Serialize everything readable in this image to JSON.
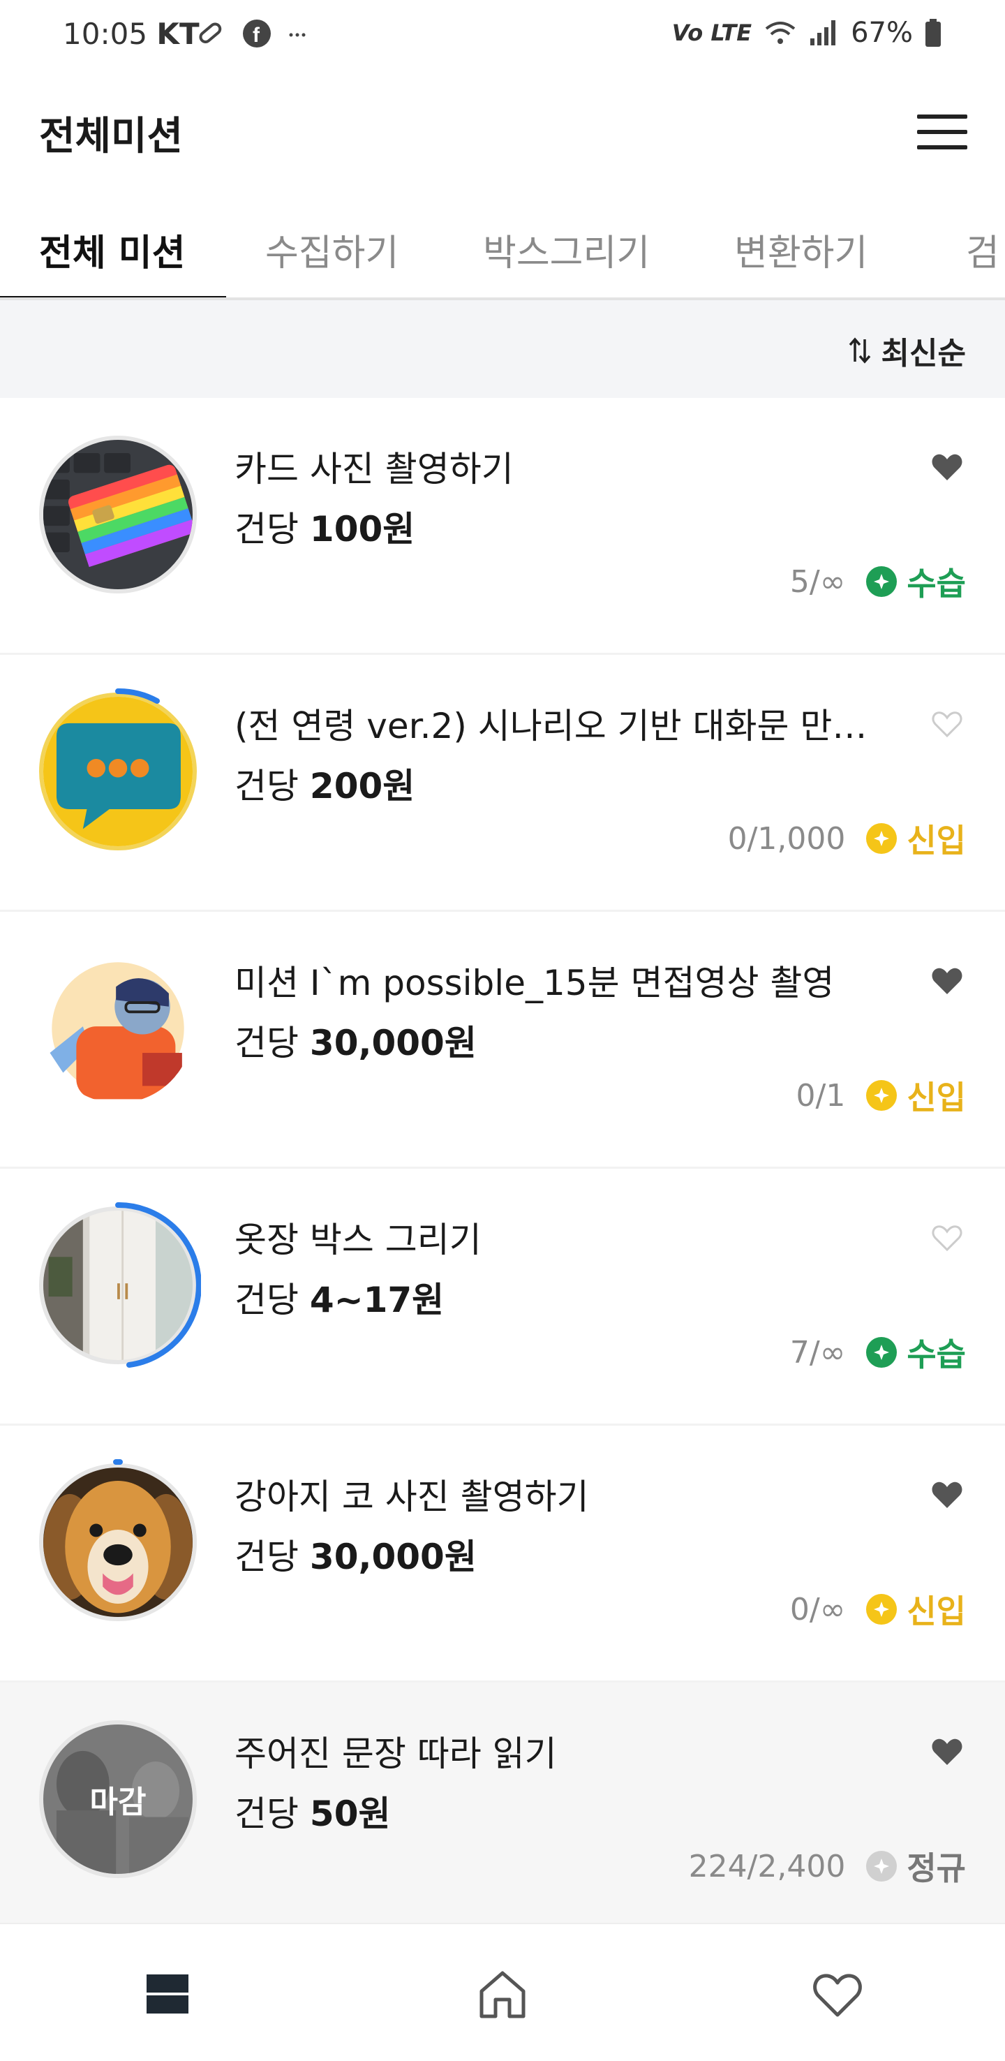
{
  "status": {
    "time": "10:05",
    "carrier": "KT",
    "network": "Vo LTE",
    "battery": "67%"
  },
  "header": {
    "title": "전체미션"
  },
  "tabs": [
    {
      "label": "전체 미션",
      "active": true
    },
    {
      "label": "수집하기",
      "active": false
    },
    {
      "label": "박스그리기",
      "active": false
    },
    {
      "label": "변환하기",
      "active": false
    },
    {
      "label": "검",
      "active": false
    }
  ],
  "sort": {
    "label": "최신순"
  },
  "missions": [
    {
      "title": "카드 사진 촬영하기",
      "price_prefix": "건당",
      "price": "100원",
      "count": "5/∞",
      "badge": "수습",
      "badge_color": "#1e9e55",
      "favorite": true,
      "closed_label": "",
      "progress": 0,
      "thumb": "card"
    },
    {
      "title": "(전 연령 ver.2) 시나리오 기반 대화문 만…",
      "price_prefix": "건당",
      "price": "200원",
      "count": "0/1,000",
      "badge": "신입",
      "badge_color": "#e8b21a",
      "favorite": false,
      "closed_label": "",
      "progress": 0.08,
      "thumb": "chat"
    },
    {
      "title": "미션 I`m possible_15분 면접영상 촬영",
      "price_prefix": "건당",
      "price": "30,000원",
      "count": "0/1",
      "badge": "신입",
      "badge_color": "#e8b21a",
      "favorite": true,
      "closed_label": "",
      "progress": 0,
      "thumb": "person"
    },
    {
      "title": "옷장 박스 그리기",
      "price_prefix": "건당",
      "price": "4~17원",
      "count": "7/∞",
      "badge": "수습",
      "badge_color": "#1e9e55",
      "favorite": false,
      "closed_label": "",
      "progress": 0.45,
      "thumb": "closet"
    },
    {
      "title": "강아지 코 사진 촬영하기",
      "price_prefix": "건당",
      "price": "30,000원",
      "count": "0/∞",
      "badge": "신입",
      "badge_color": "#e8b21a",
      "favorite": true,
      "closed_label": "",
      "progress": 0.01,
      "thumb": "dog"
    },
    {
      "title": "주어진 문장 따라 읽기",
      "price_prefix": "건당",
      "price": "50원",
      "count": "224/2,400",
      "badge": "정규",
      "badge_color": "#9a9a9a",
      "favorite": true,
      "closed_label": "마감",
      "progress": 0,
      "thumb": "closed"
    }
  ],
  "colors": {
    "accent": "#2b7de9",
    "green": "#1e9e55",
    "yellow": "#e8b21a"
  },
  "bottom_nav": [
    {
      "icon": "list-icon",
      "active": true
    },
    {
      "icon": "home-icon",
      "active": false
    },
    {
      "icon": "heart-icon",
      "active": false
    }
  ]
}
